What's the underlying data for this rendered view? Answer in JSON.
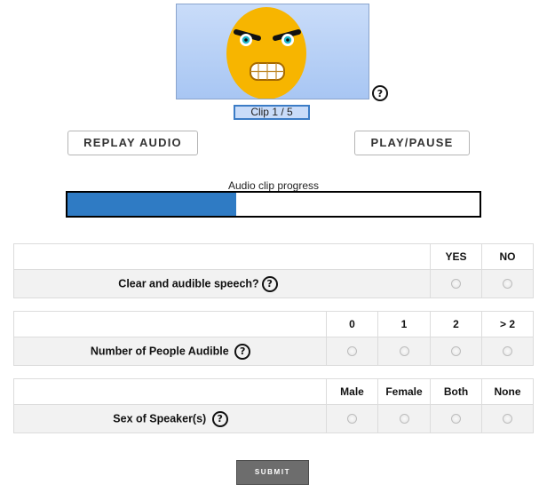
{
  "media": {
    "image": "angry-face-emoji",
    "clip_label": "Clip 1 / 5"
  },
  "controls": {
    "replay_label": "REPLAY AUDIO",
    "play_pause_label": "PLAY/PAUSE"
  },
  "progress": {
    "label": "Audio clip progress",
    "fraction": 0.41,
    "fill_color": "#2f7bc4"
  },
  "questions": [
    {
      "id": "clarity",
      "text": "Clear and audible speech?",
      "options": [
        "YES",
        "NO"
      ]
    },
    {
      "id": "people",
      "text": "Number of People Audible",
      "options": [
        "0",
        "1",
        "2",
        "> 2"
      ]
    },
    {
      "id": "sex",
      "text": "Sex of Speaker(s)",
      "options": [
        "Male",
        "Female",
        "Both",
        "None"
      ]
    }
  ],
  "submit_label": "SUBMIT"
}
